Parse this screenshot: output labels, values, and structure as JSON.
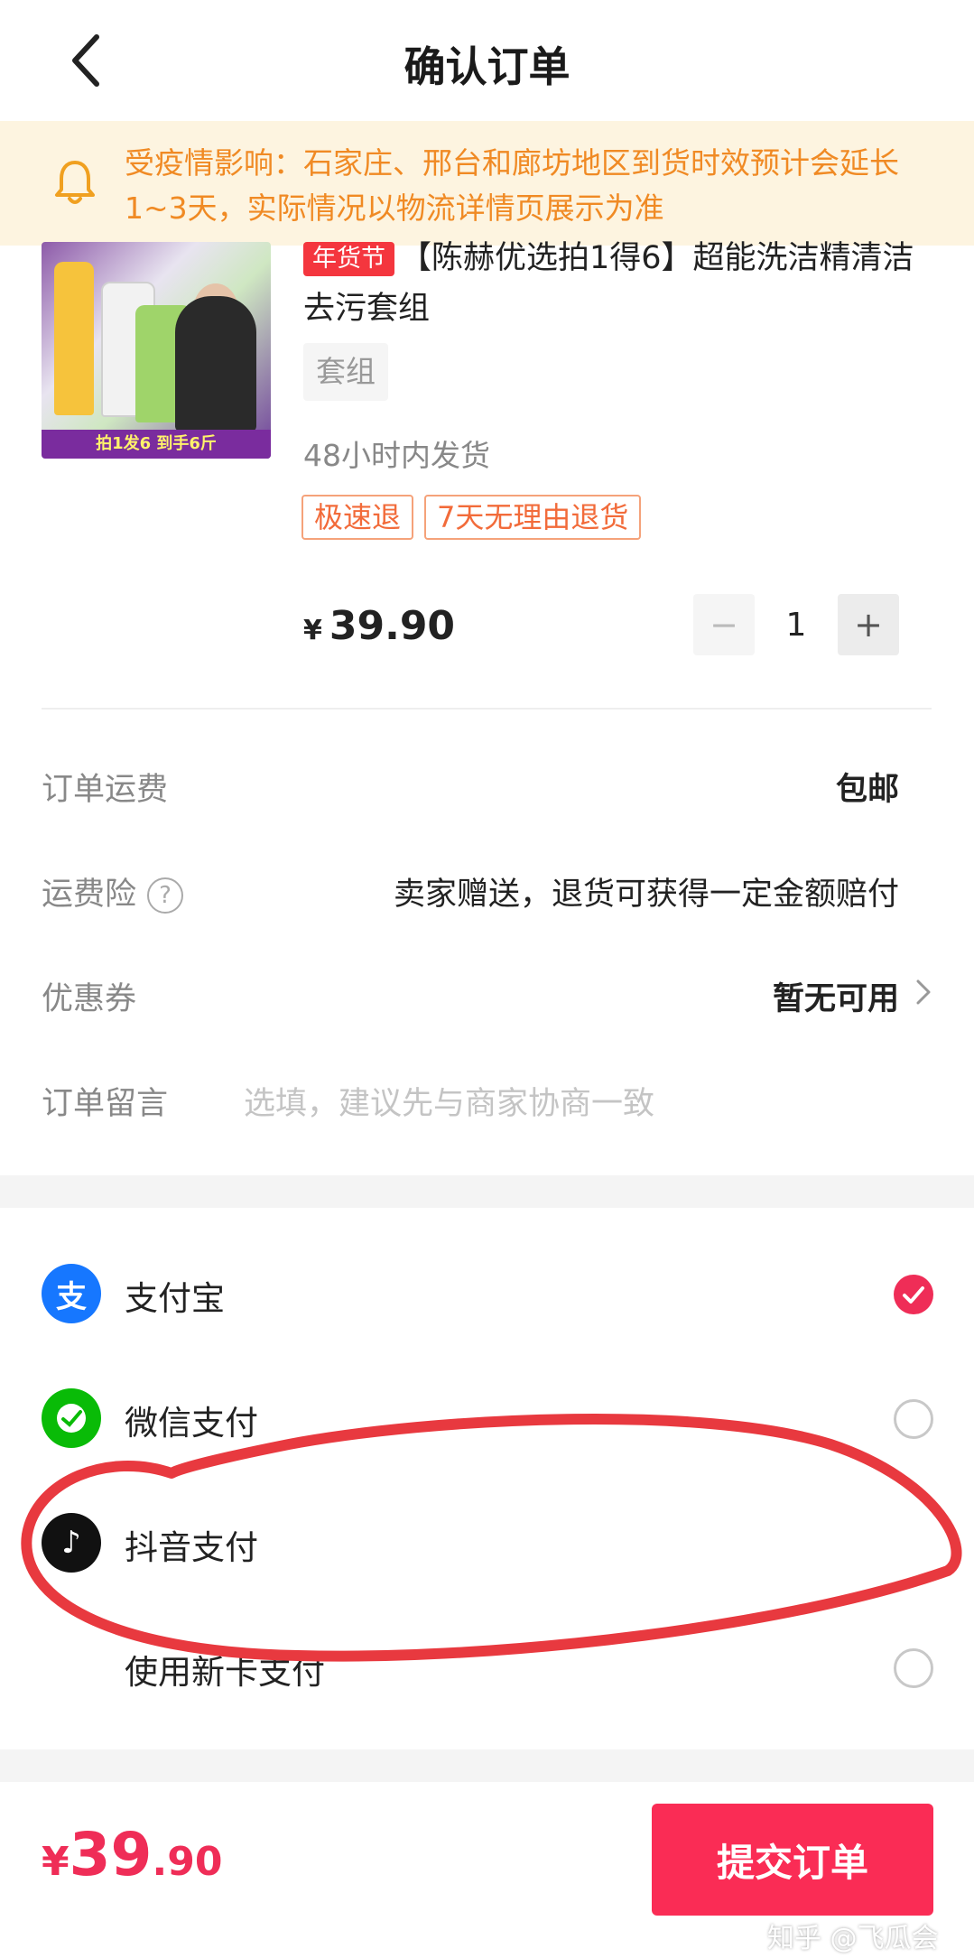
{
  "header": {
    "title": "确认订单"
  },
  "notice": {
    "text": "受疫情影响：石家庄、邢台和廊坊地区到货时效预计会延长1~3天，实际情况以物流详情页展示为准"
  },
  "product": {
    "festival_tag": "年货节",
    "title": "【陈赫优选拍1得6】超能洗洁精清洁去污套组",
    "spec": "套组",
    "ship_time": "48小时内发货",
    "service_tags": [
      "极速退",
      "7天无理由退货"
    ],
    "price_symbol": "¥",
    "price": "39.90",
    "image_banner": "拍1发6 到手6斤",
    "quantity": "1",
    "minus": "−",
    "plus": "+"
  },
  "info": {
    "shipping_fee_label": "订单运费",
    "shipping_fee_value": "包邮",
    "insurance_label": "运费险",
    "insurance_help": "?",
    "insurance_value": "卖家赠送，退货可获得一定金额赔付",
    "coupon_label": "优惠券",
    "coupon_value": "暂无可用",
    "message_label": "订单留言",
    "message_placeholder": "选填，建议先与商家协商一致"
  },
  "payments": [
    {
      "label": "支付宝",
      "icon": "alipay-icon",
      "glyph": "支",
      "color": "#1677ff",
      "selected": true
    },
    {
      "label": "微信支付",
      "icon": "wechat-pay-icon",
      "glyph": "✓",
      "color": "#09bb07",
      "selected": false
    },
    {
      "label": "抖音支付",
      "icon": "douyin-pay-icon",
      "glyph": "♪",
      "color": "#111111",
      "selected": false
    },
    {
      "label": "使用新卡支付",
      "icon": "",
      "glyph": "",
      "color": "",
      "selected": false
    }
  ],
  "footer": {
    "total_symbol": "¥",
    "total_int": "39",
    "total_dec": ".90",
    "submit_label": "提交订单",
    "watermark": "知乎 @飞瓜会"
  },
  "colors": {
    "accent": "#fa2c55",
    "notice_text": "#f08a24",
    "notice_bg": "#fdf4e0",
    "annotation": "#e8393f"
  }
}
